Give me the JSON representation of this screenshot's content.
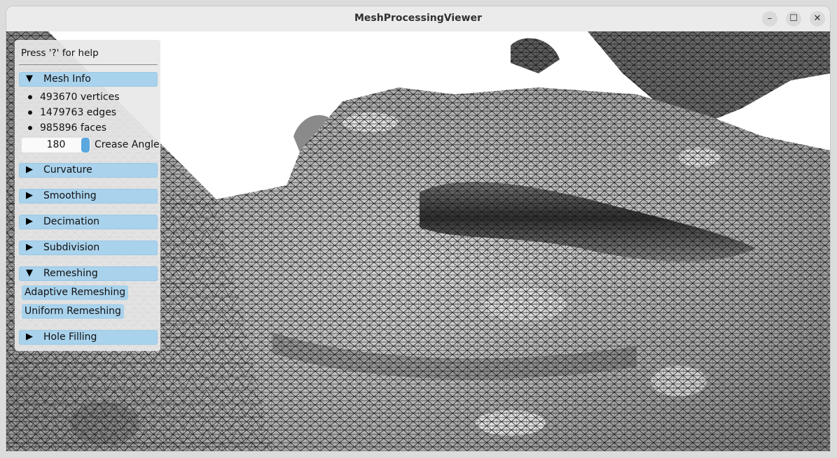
{
  "window": {
    "title": "MeshProcessingViewer"
  },
  "controls": {
    "minimize": "–",
    "maximize": "☐",
    "close": "✕"
  },
  "panel": {
    "help": "Press '?' for help",
    "sections": [
      {
        "arrow": "▼",
        "label": "Mesh Info"
      },
      {
        "arrow": "▶",
        "label": "Curvature"
      },
      {
        "arrow": "▶",
        "label": "Smoothing"
      },
      {
        "arrow": "▶",
        "label": "Decimation"
      },
      {
        "arrow": "▶",
        "label": "Subdivision"
      },
      {
        "arrow": "▼",
        "label": "Remeshing"
      },
      {
        "arrow": "▶",
        "label": "Hole Filling"
      }
    ],
    "mesh_info": {
      "vertices": "493670 vertices",
      "edges": "1479763 edges",
      "faces": "985896 faces"
    },
    "crease": {
      "value": "180",
      "label": "Crease Angle"
    },
    "remeshing": {
      "adaptive": "Adaptive Remeshing",
      "uniform": "Uniform Remeshing"
    }
  },
  "colors": {
    "accent": "#a9d2ec",
    "slider": "#5aa8de",
    "mesh_edge": "#111111"
  }
}
